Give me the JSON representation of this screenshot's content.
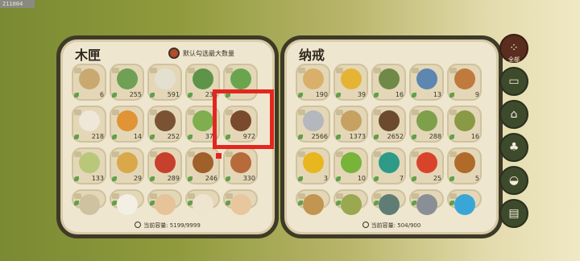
{
  "top_id": "211004",
  "left_panel": {
    "title": "木匣",
    "toggle_label": "默认勾选最大数量",
    "capacity_label": "当前容量: 5199/9999",
    "items": [
      {
        "count": "6",
        "icon": "seeds-icon",
        "color": "#c9a970"
      },
      {
        "count": "255",
        "icon": "cabbage-icon",
        "color": "#6fa053"
      },
      {
        "count": "591",
        "icon": "white-seeds-icon",
        "color": "#e4e0d0"
      },
      {
        "count": "233",
        "icon": "herb-icon",
        "color": "#5d9448"
      },
      {
        "count": "",
        "icon": "clover-icon",
        "color": "#6aa54e"
      },
      {
        "count": "218",
        "icon": "mushroom-icon",
        "color": "#efe7d9"
      },
      {
        "count": "14",
        "icon": "ginger-icon",
        "color": "#e09435"
      },
      {
        "count": "252",
        "icon": "shiitake-icon",
        "color": "#7a5234"
      },
      {
        "count": "373",
        "icon": "grass-icon",
        "color": "#7fae4e"
      },
      {
        "count": "972",
        "icon": "wood-stick-icon",
        "color": "#7a4a2c"
      },
      {
        "count": "133",
        "icon": "bean-icon",
        "color": "#b9c77a"
      },
      {
        "count": "29",
        "icon": "wheat-icon",
        "color": "#d8a84a"
      },
      {
        "count": "289",
        "icon": "chili-icon",
        "color": "#c7402b"
      },
      {
        "count": "246",
        "icon": "almond-icon",
        "color": "#a0602a"
      },
      {
        "count": "330",
        "icon": "fish-icon",
        "color": "#b76a3a"
      },
      {
        "count": "",
        "icon": "seed-icon",
        "color": "#cfc2a0"
      },
      {
        "count": "",
        "icon": "egg-icon",
        "color": "#f4efe4"
      },
      {
        "count": "",
        "icon": "chicken-icon",
        "color": "#e7c39a"
      },
      {
        "count": "",
        "icon": "garlic-icon",
        "color": "#efe4cf"
      },
      {
        "count": "",
        "icon": "radish-icon",
        "color": "#e8c79e"
      }
    ]
  },
  "right_panel": {
    "title": "纳戒",
    "capacity_label": "当前容量: 504/900",
    "items": [
      {
        "count": "190",
        "icon": "scroll-icon",
        "color": "#d8b06a"
      },
      {
        "count": "39",
        "icon": "yellow-fruit-icon",
        "color": "#e6b435"
      },
      {
        "count": "16",
        "icon": "green-pouch-icon",
        "color": "#6f8a48"
      },
      {
        "count": "13",
        "icon": "blue-pouch-icon",
        "color": "#5d86b0"
      },
      {
        "count": "9",
        "icon": "tea-pot-icon",
        "color": "#c07a3e"
      },
      {
        "count": "2566",
        "icon": "stone-icon",
        "color": "#b4b8bc"
      },
      {
        "count": "1373",
        "icon": "straw-icon",
        "color": "#c6a162"
      },
      {
        "count": "2652",
        "icon": "log-icon",
        "color": "#6b4a2e"
      },
      {
        "count": "288",
        "icon": "bamboo-icon",
        "color": "#7ea04a"
      },
      {
        "count": "16",
        "icon": "herb-bundle-icon",
        "color": "#8a9a44"
      },
      {
        "count": "3",
        "icon": "gold-orb-icon",
        "color": "#e8b61e"
      },
      {
        "count": "10",
        "icon": "green-orb-icon",
        "color": "#78b33a"
      },
      {
        "count": "7",
        "icon": "teal-orb-icon",
        "color": "#2e9a88"
      },
      {
        "count": "25",
        "icon": "red-orb-icon",
        "color": "#d8442a"
      },
      {
        "count": "5",
        "icon": "brown-orb-icon",
        "color": "#b06a2a"
      },
      {
        "count": "",
        "icon": "wood-plank-icon",
        "color": "#c29550"
      },
      {
        "count": "",
        "icon": "bamboo-slip-icon",
        "color": "#9aa850"
      },
      {
        "count": "",
        "icon": "jade-bar-icon",
        "color": "#5f7d74"
      },
      {
        "count": "",
        "icon": "iron-bar-icon",
        "color": "#8a8f96"
      },
      {
        "count": "",
        "icon": "vortex-orb-icon",
        "color": "#3aa6d8"
      }
    ]
  },
  "sidebar": [
    {
      "name": "category-all",
      "label": "全部",
      "icon": "grid-dots-icon",
      "glyph": "⁘",
      "active": true
    },
    {
      "name": "category-materials",
      "label": "",
      "icon": "log-icon",
      "glyph": "▭",
      "active": false
    },
    {
      "name": "category-building",
      "label": "",
      "icon": "pavilion-icon",
      "glyph": "⌂",
      "active": false
    },
    {
      "name": "category-herbs",
      "label": "",
      "icon": "herb-icon",
      "glyph": "♣",
      "active": false
    },
    {
      "name": "category-food",
      "label": "",
      "icon": "bowl-icon",
      "glyph": "◒",
      "active": false
    },
    {
      "name": "category-scrolls",
      "label": "",
      "icon": "scroll-icon",
      "glyph": "▤",
      "active": false
    }
  ],
  "colors": {
    "highlight": "#e3261e",
    "panel_border": "#3d3a28",
    "panel_bg": "#efe6cf"
  }
}
